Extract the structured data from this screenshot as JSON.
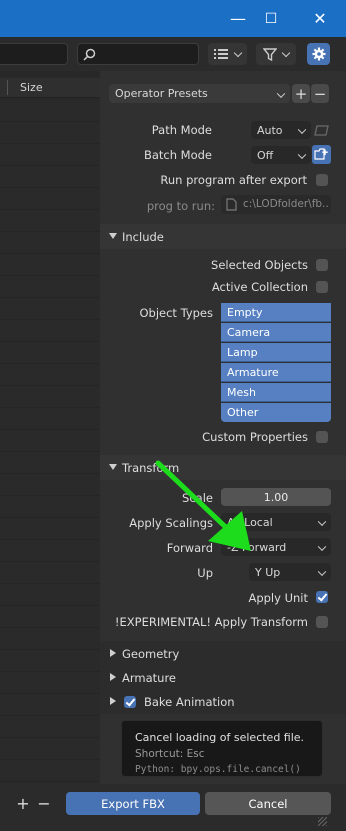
{
  "window": {
    "minimize": "—",
    "maximize": "☐",
    "close": "✕"
  },
  "toolbar": {
    "search_placeholder": ""
  },
  "filelist": {
    "size_header": "Size"
  },
  "presets": {
    "label": "Operator Presets",
    "add": "+",
    "remove": "−"
  },
  "main": {
    "path_mode_label": "Path Mode",
    "path_mode_value": "Auto",
    "batch_mode_label": "Batch Mode",
    "batch_mode_value": "Off",
    "run_program_label": "Run program after export",
    "prog_label": "prog to run:",
    "prog_value": "c:\\LODfolder\\fb..."
  },
  "include": {
    "header": "Include",
    "selected_objects": "Selected Objects",
    "active_collection": "Active Collection",
    "object_types_label": "Object Types",
    "object_types": [
      "Empty",
      "Camera",
      "Lamp",
      "Armature",
      "Mesh",
      "Other"
    ],
    "custom_properties": "Custom Properties"
  },
  "transform": {
    "header": "Transform",
    "scale_label": "Scale",
    "scale_value": "1.00",
    "apply_scalings_label": "Apply Scalings",
    "apply_scalings_value": "All Local",
    "forward_label": "Forward",
    "forward_value": "-Z Forward",
    "up_label": "Up",
    "up_value": "Y Up",
    "apply_unit": "Apply Unit",
    "apply_transform": "!EXPERIMENTAL! Apply Transform"
  },
  "sections": {
    "geometry": "Geometry",
    "armature": "Armature",
    "bake_animation": "Bake Animation"
  },
  "tooltip": {
    "title": "Cancel loading of selected file.",
    "shortcut": "Shortcut: Esc",
    "python": "Python: bpy.ops.file.cancel()"
  },
  "bottom": {
    "plus": "+",
    "minus": "−",
    "export": "Export FBX",
    "cancel": "Cancel"
  },
  "colors": {
    "accent": "#4772b3",
    "titlebar": "#1b6fc4",
    "annotation_arrow": "#1cdc1c"
  }
}
